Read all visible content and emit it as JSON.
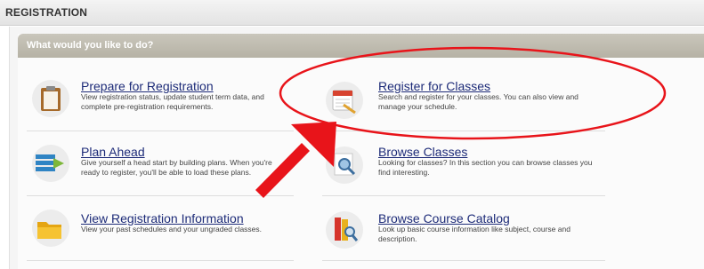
{
  "page": {
    "title": "REGISTRATION"
  },
  "panel": {
    "heading": "What would you like to do?"
  },
  "items": [
    {
      "title": "Prepare for Registration",
      "desc": "View registration status, update student term data, and complete pre-registration requirements.",
      "icon": "clipboard-icon"
    },
    {
      "title": "Register for Classes",
      "desc": "Search and register for your classes. You can also view and manage your schedule.",
      "icon": "calendar-pencil-icon"
    },
    {
      "title": "Plan Ahead",
      "desc": "Give yourself a head start by building plans. When you're ready to register, you'll be able to load these plans.",
      "icon": "stack-icon"
    },
    {
      "title": "Browse Classes",
      "desc": "Looking for classes? In this section you can browse classes you find interesting.",
      "icon": "magnifier-icon"
    },
    {
      "title": "View Registration Information",
      "desc": "View your past schedules and your ungraded classes.",
      "icon": "folder-icon"
    },
    {
      "title": "Browse Course Catalog",
      "desc": "Look up basic course information like subject, course and description.",
      "icon": "books-icon"
    }
  ],
  "colors": {
    "link": "#1d2b78",
    "annotation": "#e8141a",
    "header": "#b9b5a8"
  }
}
